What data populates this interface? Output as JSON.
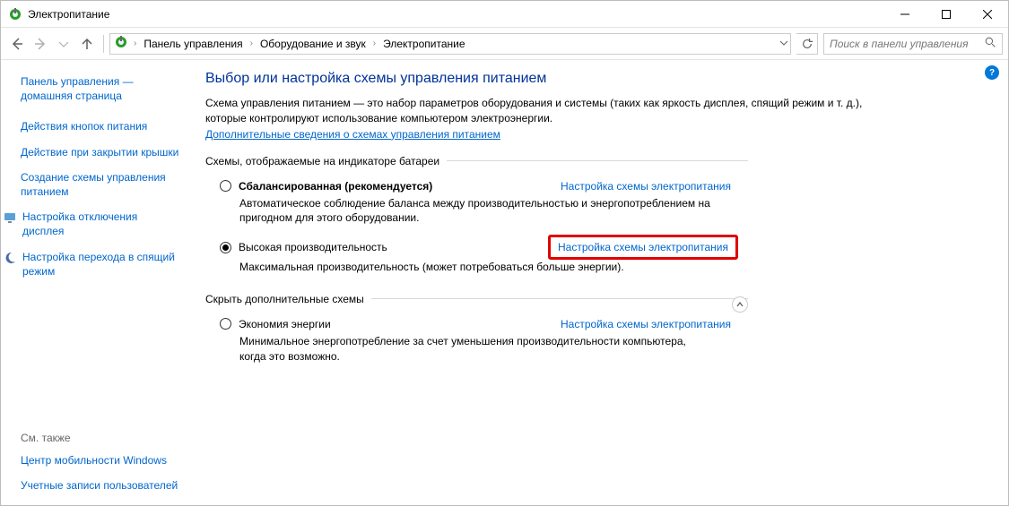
{
  "window": {
    "title": "Электропитание"
  },
  "breadcrumb": {
    "items": [
      "Панель управления",
      "Оборудование и звук",
      "Электропитание"
    ]
  },
  "search": {
    "placeholder": "Поиск в панели управления"
  },
  "sidebar": {
    "home": "Панель управления — домашняя страница",
    "links": [
      "Действия кнопок питания",
      "Действие при закрытии крышки",
      "Создание схемы управления питанием"
    ],
    "icon_links": [
      {
        "label": "Настройка отключения дисплея"
      },
      {
        "label": "Настройка перехода в спящий режим"
      }
    ],
    "see_also_heading": "См. также",
    "see_also": [
      "Центр мобильности Windows",
      "Учетные записи пользователей"
    ]
  },
  "main": {
    "title": "Выбор или настройка схемы управления питанием",
    "description": "Схема управления питанием — это набор параметров оборудования и системы (таких как яркость дисплея, спящий режим и т. д.), которые контролируют использование компьютером электроэнергии.",
    "learn_more": "Дополнительные сведения о схемах управления питанием",
    "group_shown": "Схемы, отображаемые на индикаторе батареи",
    "group_hidden": "Скрыть дополнительные схемы",
    "plans": {
      "change_link": "Настройка схемы электропитания",
      "balanced": {
        "name": "Сбалансированная (рекомендуется)",
        "desc": "Автоматическое соблюдение баланса между производительностью и энергопотреблением на пригодном для этого оборудовании."
      },
      "high": {
        "name": "Высокая производительность",
        "desc": "Максимальная производительность (может потребоваться больше энергии)."
      },
      "saver": {
        "name": "Экономия энергии",
        "desc": "Минимальное энергопотребление за счет уменьшения производительности компьютера, когда это возможно."
      }
    }
  }
}
